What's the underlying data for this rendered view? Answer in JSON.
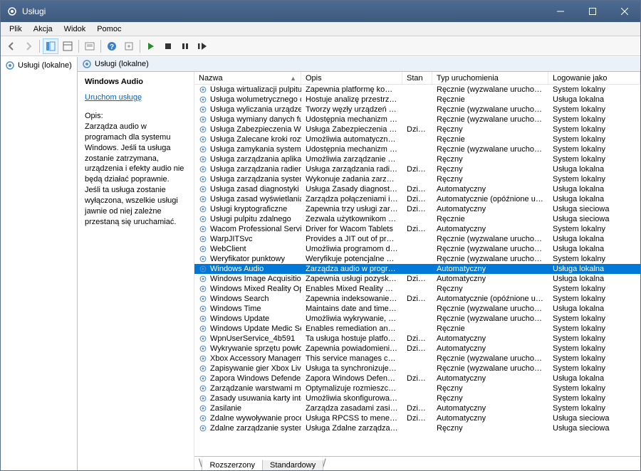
{
  "title": "Usługi",
  "menubar": [
    "Plik",
    "Akcja",
    "Widok",
    "Pomoc"
  ],
  "tree": {
    "root": "Usługi (lokalne)"
  },
  "rightHeader": "Usługi (lokalne)",
  "detail": {
    "title": "Windows Audio",
    "link": "Uruchom usługę",
    "opisLabel": "Opis:",
    "opis": "Zarządza audio w programach dla systemu Windows. Jeśli ta usługa zostanie zatrzymana, urządzenia i efekty audio nie będą działać poprawnie. Jeśli ta usługa zostanie wyłączona, wszelkie usługi jawnie od niej zależne przestaną się uruchamiać."
  },
  "columns": {
    "nazwa": "Nazwa",
    "opis": "Opis",
    "stan": "Stan",
    "start": "Typ uruchomienia",
    "log": "Logowanie jako"
  },
  "tabs": {
    "ext": "Rozszerzony",
    "std": "Standardowy"
  },
  "rows": [
    {
      "n": "Usługa wirtualizacji pulpitu zdalneg...",
      "o": "Zapewnia platformę komuni...",
      "s": "",
      "t": "Ręcznie (wyzwalane uruchomienie)",
      "l": "System lokalny"
    },
    {
      "n": "Usługa wolumetrycznego cieniowa...",
      "o": "Hostuje analizę przestrzenną sł...",
      "s": "",
      "t": "Ręcznie",
      "l": "Usługa lokalna"
    },
    {
      "n": "Usługa wyliczania urządzeń karty int...",
      "o": "Tworzy węzły urządzeń progra...",
      "s": "",
      "t": "Ręcznie (wyzwalane uruchomienie)",
      "l": "System lokalny"
    },
    {
      "n": "Usługa wymiany danych funkcji Hy...",
      "o": "Udostępnia mechanizm wymi...",
      "s": "",
      "t": "Ręcznie (wyzwalane uruchomienie)",
      "l": "System lokalny"
    },
    {
      "n": "Usługa Zabezpieczenia Windows",
      "o": "Usługa Zabezpieczenia Windo...",
      "s": "Działa",
      "t": "Ręczny",
      "l": "System lokalny"
    },
    {
      "n": "Usługa Zalecane kroki rozwiązywan...",
      "o": "Umożliwia automatyczne elim...",
      "s": "",
      "t": "Ręcznie",
      "l": "System lokalny"
    },
    {
      "n": "Usługa zamykania systemu gościa f...",
      "o": "Udostępnia mechanizm zamy...",
      "s": "",
      "t": "Ręcznie (wyzwalane uruchomienie)",
      "l": "System lokalny"
    },
    {
      "n": "Usługa zarządzania aplikacjami w pr...",
      "o": "Umożliwia zarządzanie aplikac...",
      "s": "",
      "t": "Ręczny",
      "l": "System lokalny"
    },
    {
      "n": "Usługa zarządzania radiem",
      "o": "Usługa zarządzania radiem i tr...",
      "s": "Działa",
      "t": "Ręczny",
      "l": "Usługa lokalna"
    },
    {
      "n": "Usługa zarządzania systemu Windo...",
      "o": "Wykonuje zadania zarządzania...",
      "s": "",
      "t": "Ręczny",
      "l": "System lokalny"
    },
    {
      "n": "Usługa zasad diagnostyki",
      "o": "Usługa Zasady diagnostyki u...",
      "s": "Działa",
      "t": "Automatyczny",
      "l": "Usługa lokalna"
    },
    {
      "n": "Usługa zasad wyświetlania",
      "o": "Zarządza połączeniami i konfi...",
      "s": "Działa",
      "t": "Automatycznie (opóźnione uruchom...",
      "l": "Usługa lokalna"
    },
    {
      "n": "Usługi kryptograficzne",
      "o": "Zapewnia trzy usługi zarządza...",
      "s": "Działa",
      "t": "Automatyczny",
      "l": "Usługa sieciowa"
    },
    {
      "n": "Usługi pulpitu zdalnego",
      "o": "Zezwala użytkownikom na int...",
      "s": "",
      "t": "Ręcznie",
      "l": "Usługa sieciowa"
    },
    {
      "n": "Wacom Professional Service",
      "o": "Driver for Wacom Tablets",
      "s": "Działa",
      "t": "Automatyczny",
      "l": "System lokalny"
    },
    {
      "n": "WarpJITSvc",
      "o": "Provides a JIT out of process s...",
      "s": "",
      "t": "Ręcznie (wyzwalane uruchomienie)",
      "l": "Usługa lokalna"
    },
    {
      "n": "WebClient",
      "o": "Umożliwia programom dla sys...",
      "s": "",
      "t": "Ręcznie (wyzwalane uruchomienie)",
      "l": "Usługa lokalna"
    },
    {
      "n": "Weryfikator punktowy",
      "o": "Weryfikuje potencjalne uszko...",
      "s": "",
      "t": "Ręcznie (wyzwalane uruchomienie)",
      "l": "System lokalny"
    },
    {
      "n": "Windows Audio",
      "o": "Zarządza audio w programach...",
      "s": "",
      "t": "Automatyczny",
      "l": "Usługa lokalna",
      "sel": true
    },
    {
      "n": "Windows Image Acquisition (WIA)",
      "o": "Zapewnia usługi pozyskiwania...",
      "s": "Działa",
      "t": "Automatyczny",
      "l": "Usługa lokalna"
    },
    {
      "n": "Windows Mixed Reality OpenXR Ser...",
      "o": "Enables Mixed Reality OpenXR...",
      "s": "",
      "t": "Ręczny",
      "l": "System lokalny"
    },
    {
      "n": "Windows Search",
      "o": "Zapewnia indeksowanie zawar...",
      "s": "Działa",
      "t": "Automatycznie (opóźnione uruchom...",
      "l": "System lokalny"
    },
    {
      "n": "Windows Time",
      "o": "Maintains date and time sync...",
      "s": "",
      "t": "Ręcznie (wyzwalane uruchomienie)",
      "l": "Usługa lokalna"
    },
    {
      "n": "Windows Update",
      "o": "Umożliwia wykrywanie, pobier...",
      "s": "",
      "t": "Ręcznie (wyzwalane uruchomienie)",
      "l": "System lokalny"
    },
    {
      "n": "Windows Update Medic Service",
      "o": "Enables remediation and prot...",
      "s": "",
      "t": "Ręcznie",
      "l": "System lokalny"
    },
    {
      "n": "WpnUserService_4b591",
      "o": "Ta usługa hostuje platformę p...",
      "s": "Działa",
      "t": "Automatyczny",
      "l": "System lokalny"
    },
    {
      "n": "Wykrywanie sprzętu powłoki",
      "o": "Zapewnia powiadomienia o z...",
      "s": "Działa",
      "t": "Automatyczny",
      "l": "System lokalny"
    },
    {
      "n": "Xbox Accessory Management Service",
      "o": "This service manages connect...",
      "s": "",
      "t": "Ręcznie (wyzwalane uruchomienie)",
      "l": "System lokalny"
    },
    {
      "n": "Zapisywanie gier Xbox Live",
      "o": "Usługa ta synchronizuje zapisa...",
      "s": "",
      "t": "Ręcznie (wyzwalane uruchomienie)",
      "l": "System lokalny"
    },
    {
      "n": "Zapora Windows Defender",
      "o": "Zapora Windows Defender po...",
      "s": "Działa",
      "t": "Automatyczny",
      "l": "Usługa lokalna"
    },
    {
      "n": "Zarządzanie warstwami magazyno...",
      "o": "Optymalizuje rozmieszczenie ...",
      "s": "",
      "t": "Ręczny",
      "l": "System lokalny"
    },
    {
      "n": "Zasady usuwania karty inteligentnej",
      "o": "Umożliwia skonfigurowanie s...",
      "s": "",
      "t": "Ręczny",
      "l": "System lokalny"
    },
    {
      "n": "Zasilanie",
      "o": "Zarządza zasadami zasilania i ...",
      "s": "Działa",
      "t": "Automatyczny",
      "l": "System lokalny"
    },
    {
      "n": "Zdalne wywoływanie procedur (RPC)",
      "o": "Usługa RPCSS to menedżer ste...",
      "s": "Działa",
      "t": "Automatyczny",
      "l": "Usługa sieciowa"
    },
    {
      "n": "Zdalne zarządzanie systemem Wind...",
      "o": "Usługa Zdalne zarządzanie sys...",
      "s": "",
      "t": "Ręczny",
      "l": "Usługa sieciowa"
    }
  ]
}
